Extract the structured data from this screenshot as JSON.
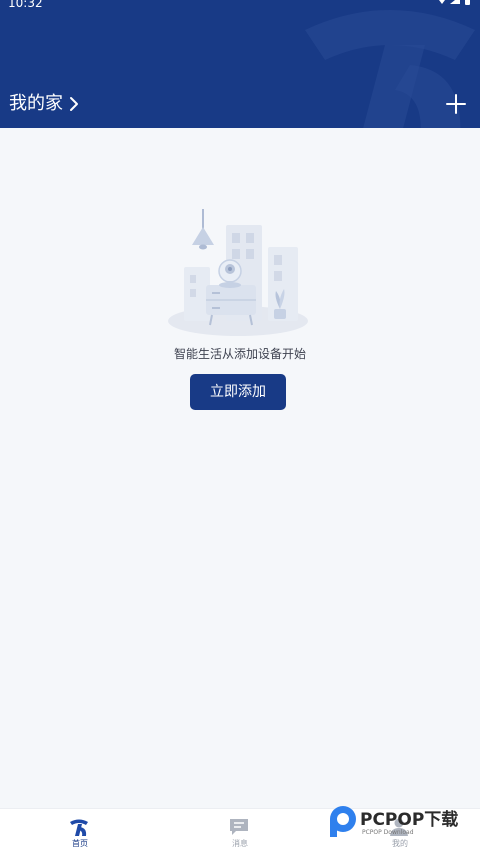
{
  "status_bar": {
    "time": "10:32"
  },
  "header": {
    "title": "我的家",
    "chevron_icon": "chevron-right-icon",
    "add_icon": "plus-icon",
    "background_color": "#183a86"
  },
  "empty_state": {
    "illustration_icon": "smart-home-illustration",
    "message": "智能生活从添加设备开始",
    "button_label": "立即添加",
    "button_color": "#183a86"
  },
  "bottom_nav": {
    "items": [
      {
        "label": "首页",
        "icon": "home-logo-icon",
        "active": true
      },
      {
        "label": "消息",
        "icon": "message-icon",
        "active": false
      },
      {
        "label": "我的",
        "icon": "profile-icon",
        "active": false
      }
    ],
    "active_color": "#183a86",
    "inactive_color": "#9aa0ab"
  },
  "watermark": {
    "text": "PCPOP下载",
    "subtext": "PCPOP Download"
  }
}
